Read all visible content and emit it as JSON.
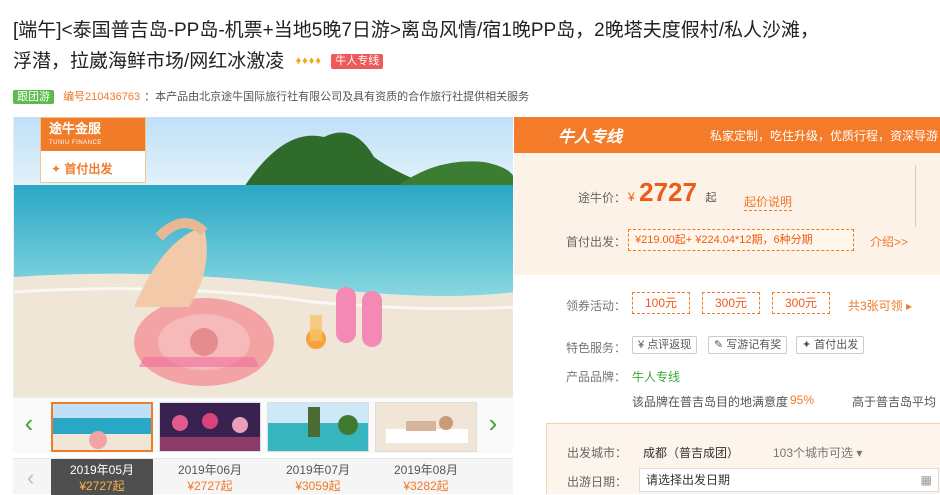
{
  "product": {
    "title_line1": "[端午]<泰国普吉岛-PP岛-机票+当地5晚7日游>离岛风情/宿1晚PP岛，2晚塔夫度假村/私人沙滩，",
    "title_line2": "浮潜，拉崴海鲜市场/网红冰激凌",
    "diamonds": "♦♦♦♦",
    "tag": "牛人专线",
    "group_badge": "跟团游",
    "code": "编号210436763",
    "provider_text": "：本产品由北京途牛国际旅行社有限公司及具有资质的合作旅行社提供相关服务"
  },
  "gallery": {
    "badge_brand": "途牛金服",
    "badge_brand_en": "TUNIU FINANCE",
    "badge_sub": "首付出发",
    "prev_icon": "‹",
    "next_icon": "›",
    "months": [
      {
        "month": "2019年05月",
        "price": "¥2727起"
      },
      {
        "month": "2019年06月",
        "price": "¥2727起"
      },
      {
        "month": "2019年07月",
        "price": "¥3059起"
      },
      {
        "month": "2019年08月",
        "price": "¥3282起"
      }
    ]
  },
  "panel": {
    "logo": "牛人专线",
    "slogan": "私家定制，吃住升级，优质行程，资深导游",
    "price_label": "途牛价：",
    "yen": "¥",
    "price": "2727",
    "qi": "起",
    "price_help": "起价说明",
    "firstpay_label": "首付出发：",
    "firstpay_value": "¥219.00起+ ¥224.04*12期，6种分期",
    "firstpay_link": "介绍>>",
    "coupon_label": "领券活动：",
    "coupons": [
      "100元",
      "300元",
      "300元"
    ],
    "coupon_more": "共3张可领 ▸",
    "feature_label": "特色服务：",
    "features": [
      "点评返现",
      "写游记有奖",
      "首付出发"
    ],
    "brand_label": "产品品牌：",
    "brand_value": "牛人专线",
    "satisfaction_text": "该品牌在普吉岛目的地满意度",
    "satisfaction_value": "95%",
    "compare_text": "高于普吉岛平均",
    "depart_label": "出发城市：",
    "depart_value": "成都（普吉成团）",
    "depart_more": "103个城市可选 ▾",
    "date_label": "出游日期：",
    "date_placeholder": "请选择出发日期"
  }
}
